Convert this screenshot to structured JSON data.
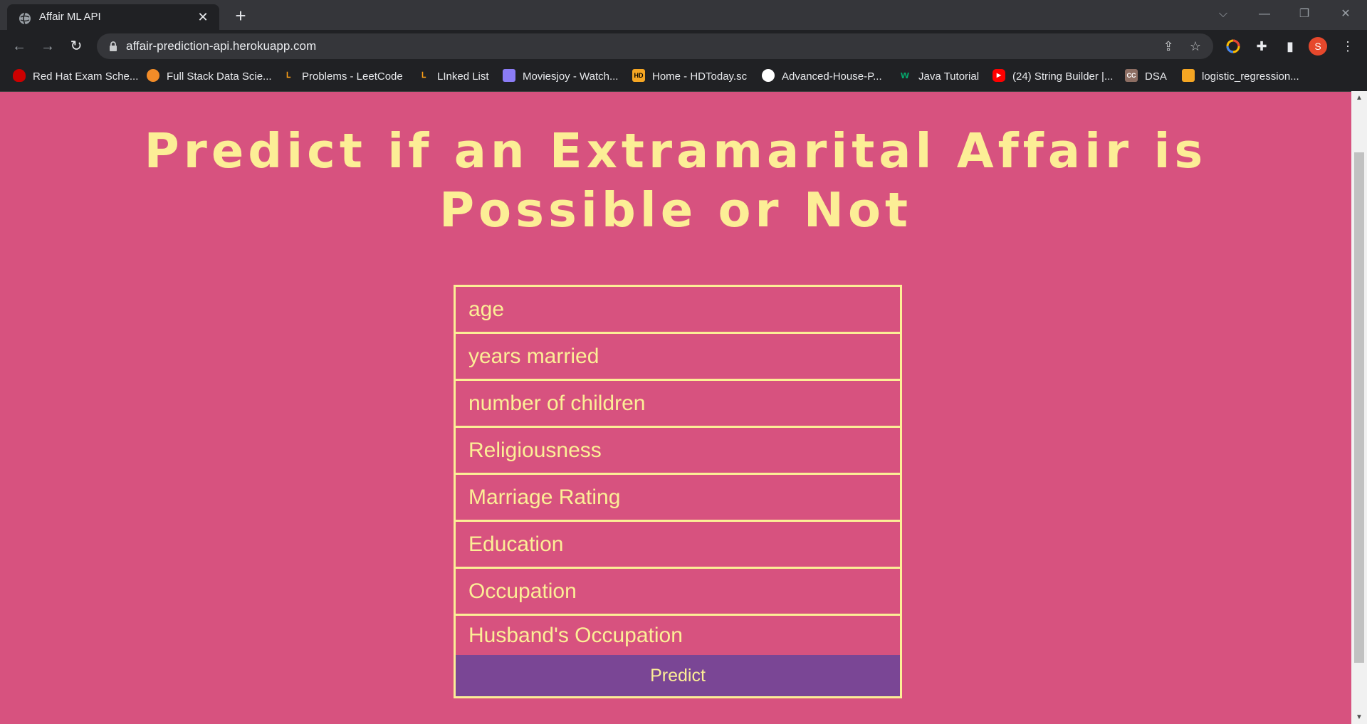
{
  "browser": {
    "tab_title": "Affair ML API",
    "url": "affair-prediction-api.herokuapp.com",
    "profile_initial": "S",
    "bookmarks": [
      {
        "label": "Red Hat Exam Sche...",
        "icon": "redhat-icon",
        "color": "#cc0000"
      },
      {
        "label": "Full Stack Data Scie...",
        "icon": "orange-circle-icon",
        "color": "#f28c28"
      },
      {
        "label": "Problems - LeetCode",
        "icon": "leetcode-icon",
        "color": "#ffa116"
      },
      {
        "label": "LInked List",
        "icon": "leetcode-icon",
        "color": "#ffa116"
      },
      {
        "label": "Moviesjoy - Watch...",
        "icon": "camera-icon",
        "color": "#8b7cf6"
      },
      {
        "label": "Home - HDToday.sc",
        "icon": "hd-icon",
        "color": "#f5a623"
      },
      {
        "label": "Advanced-House-P...",
        "icon": "github-icon",
        "color": "#ffffff"
      },
      {
        "label": "Java Tutorial",
        "icon": "w3schools-icon",
        "color": "#04aa6d"
      },
      {
        "label": "(24) String Builder |...",
        "icon": "youtube-icon",
        "color": "#ff0000"
      },
      {
        "label": "DSA",
        "icon": "cc-icon",
        "color": "#8d6e63"
      },
      {
        "label": "logistic_regression...",
        "icon": "book-icon",
        "color": "#f5a623"
      }
    ]
  },
  "page": {
    "title": "Predict if an Extramarital Affair is Possible or Not",
    "fields": [
      {
        "name": "age-input",
        "placeholder": "age"
      },
      {
        "name": "years-married-input",
        "placeholder": "years married"
      },
      {
        "name": "number-of-children-input",
        "placeholder": "number of children"
      },
      {
        "name": "religiousness-input",
        "placeholder": "Religiousness"
      },
      {
        "name": "marriage-rating-input",
        "placeholder": "Marriage Rating"
      },
      {
        "name": "education-input",
        "placeholder": "Education"
      },
      {
        "name": "occupation-input",
        "placeholder": "Occupation"
      },
      {
        "name": "husbands-occupation-input",
        "placeholder": "Husband's Occupation"
      }
    ],
    "predict_label": "Predict"
  },
  "colors": {
    "background": "#d7527f",
    "accent": "#fcee96",
    "button": "#7a4695"
  }
}
